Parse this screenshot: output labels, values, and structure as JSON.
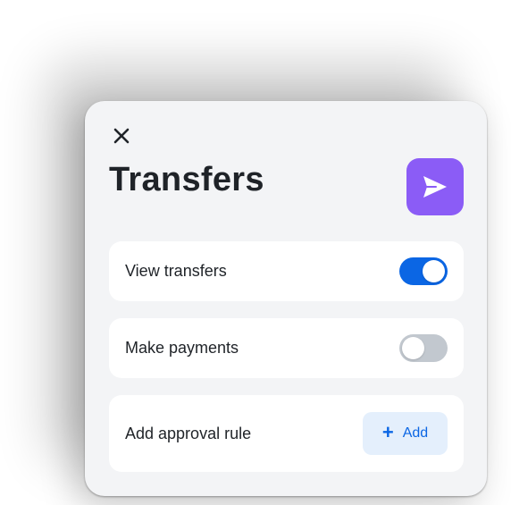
{
  "panel": {
    "title": "Transfers",
    "close_icon": "close-icon",
    "app_icon": "send-icon",
    "accent_color": "#8b5cf6"
  },
  "permissions": [
    {
      "label": "View transfers",
      "enabled": true
    },
    {
      "label": "Make payments",
      "enabled": false
    }
  ],
  "approval": {
    "label": "Add approval rule",
    "button_label": "Add",
    "button_icon": "plus-icon"
  },
  "colors": {
    "toggle_on": "#0b66e4",
    "toggle_off": "#c2c8cf",
    "button_bg": "#e4effc"
  }
}
